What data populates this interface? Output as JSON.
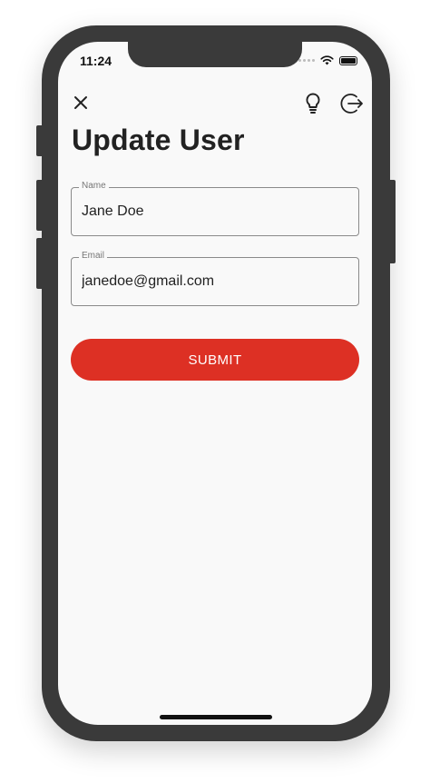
{
  "status_bar": {
    "time": "11:24"
  },
  "header": {
    "close_icon": "close-icon",
    "bulb_icon": "lightbulb-icon",
    "logout_icon": "logout-icon"
  },
  "page": {
    "title": "Update User"
  },
  "form": {
    "name": {
      "label": "Name",
      "value": "Jane Doe"
    },
    "email": {
      "label": "Email",
      "value": "janedoe@gmail.com"
    },
    "submit_label": "SUBMIT"
  },
  "colors": {
    "accent": "#dd3024",
    "frame": "#3a3a3a",
    "screen_bg": "#f9f9f9"
  }
}
